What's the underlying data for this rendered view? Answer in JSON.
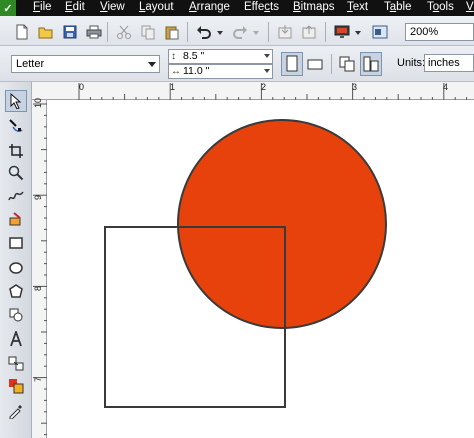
{
  "menu": {
    "items": [
      {
        "first": "F",
        "rest": "ile"
      },
      {
        "first": "E",
        "rest": "dit"
      },
      {
        "first": "V",
        "rest": "iew"
      },
      {
        "first": "L",
        "rest": "ayout"
      },
      {
        "first": "A",
        "rest": "rrange"
      },
      {
        "first": "",
        "rest": "Effe",
        "u": "c",
        "tail": "ts"
      },
      {
        "first": "B",
        "rest": "itmaps"
      },
      {
        "first": "T",
        "rest": "ext"
      },
      {
        "first": "",
        "rest": "T",
        "u": "a",
        "tail": "ble"
      },
      {
        "first": "",
        "rest": "T",
        "u": "o",
        "tail": "ols"
      },
      {
        "first": "",
        "rest": "",
        "u": "V",
        "tail": ""
      }
    ]
  },
  "toolbar": {
    "zoom": "200%"
  },
  "property_bar": {
    "page_size": "Letter",
    "width": "8.5 \"",
    "height": "11.0 \"",
    "units_label": "Units:",
    "units_value": "inches"
  },
  "ruler": {
    "h_labels": [
      "0",
      "1",
      "2",
      "3",
      "4"
    ],
    "v_labels": [
      "10",
      "9",
      "8",
      "7"
    ]
  },
  "colors": {
    "circle_fill": "#e8420c",
    "outline": "#3a3a3a",
    "canvas": "#ffffff"
  },
  "icons": [
    "new-icon",
    "open-icon",
    "save-icon",
    "print-icon",
    "cut-icon",
    "copy-icon",
    "paste-icon",
    "undo-icon",
    "redo-icon",
    "import-icon",
    "export-icon",
    "launcher-icon",
    "welcome-icon"
  ]
}
